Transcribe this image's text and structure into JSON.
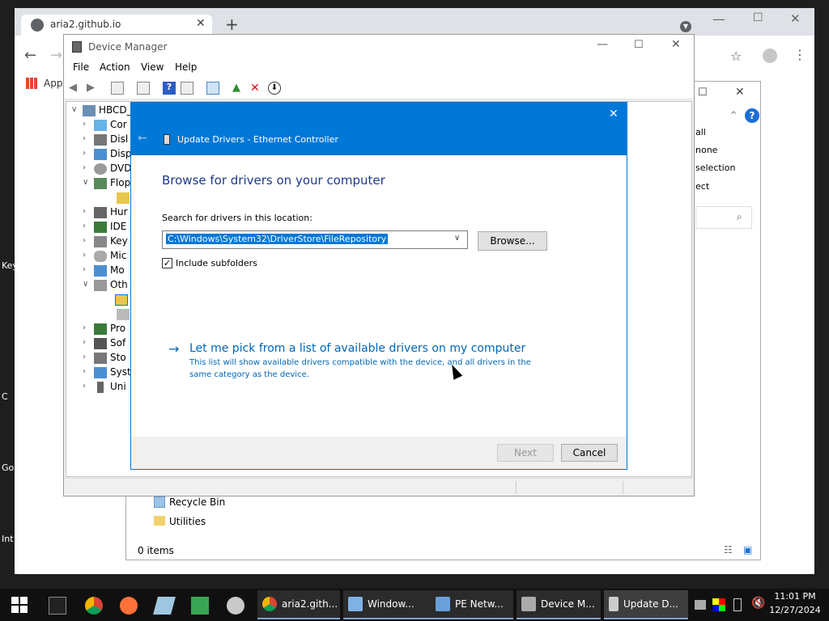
{
  "desktop": {
    "labels": [
      "Key",
      "C",
      "Go",
      "Int"
    ]
  },
  "chrome": {
    "tab_title": "aria2.github.io",
    "bookmark_apps": "Apps"
  },
  "explorer": {
    "side_items": [
      "all",
      "none",
      "selection",
      "ect"
    ],
    "files": [
      "Recycle Bin",
      "Utilities"
    ],
    "status": "0 items"
  },
  "devmgr": {
    "title": "Device Manager",
    "menu": [
      "File",
      "Action",
      "View",
      "Help"
    ],
    "root": "HBCD_",
    "tree": [
      "Cor",
      "Disl",
      "Disp",
      "DVD",
      "Flop",
      "",
      "Hur",
      "IDE",
      "Key",
      "Mic",
      "Mo",
      "Oth",
      "",
      "",
      "Pro",
      "Sof",
      "Sto",
      "Syst",
      "Uni"
    ]
  },
  "dialog": {
    "header_title": "Update Drivers - Ethernet Controller",
    "heading": "Browse for drivers on your computer",
    "search_label": "Search for drivers in this location:",
    "path_value": "C:\\Windows\\System32\\DriverStore\\FileRepository",
    "browse_label": "Browse...",
    "include_subfolders": "Include subfolders",
    "pick_link": "Let me pick from a list of available drivers on my computer",
    "pick_desc_1": "This list will show available drivers compatible with the device, and all drivers in the",
    "pick_desc_2": "same category as the device.",
    "next_label": "Next",
    "cancel_label": "Cancel"
  },
  "taskbar": {
    "buttons": [
      "aria2.gith...",
      "Window...",
      "PE Netw...",
      "Device M...",
      "Update D..."
    ],
    "time": "11:01 PM",
    "date": "12/27/2024"
  },
  "colors": {
    "accent": "#0078d7",
    "link": "#0066b4"
  }
}
